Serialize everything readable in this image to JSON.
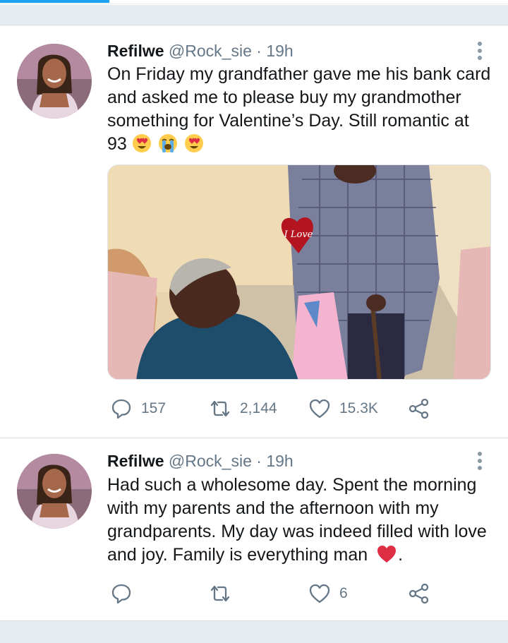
{
  "colors": {
    "accent": "#1da1f2",
    "text": "#14171a",
    "muted": "#657786",
    "divider": "#e6ecf0",
    "heart_emoji": "#e0245e"
  },
  "tweets": [
    {
      "name": "Refilwe",
      "handle": "@Rock_sie",
      "separator": "·",
      "time": "19h",
      "text_lines": [
        "On Friday my grandfather gave me his bank card",
        "and asked me to please buy my grandmother",
        "something for Valentine’s Day. Still romantic at",
        "93"
      ],
      "emojis": [
        "heart-eyes-emoji",
        "crying-emoji",
        "heart-eyes-emoji"
      ],
      "media": {
        "type": "photo",
        "balloon_text": "I Love",
        "icon": "photo-placeholder"
      },
      "actions": {
        "replies": "157",
        "retweets": "2,144",
        "likes": "15.3K"
      }
    },
    {
      "name": "Refilwe",
      "handle": "@Rock_sie",
      "separator": "·",
      "time": "19h",
      "text_lines": [
        "Had such a wholesome day. Spent the morning",
        "with my parents and the afternoon with my",
        "grandparents. My day was indeed filled with love",
        "and joy. Family is everything man"
      ],
      "trailing_text": ".",
      "emojis": [
        "red-heart-emoji"
      ],
      "actions": {
        "replies": "",
        "retweets": "",
        "likes": "6"
      }
    }
  ]
}
